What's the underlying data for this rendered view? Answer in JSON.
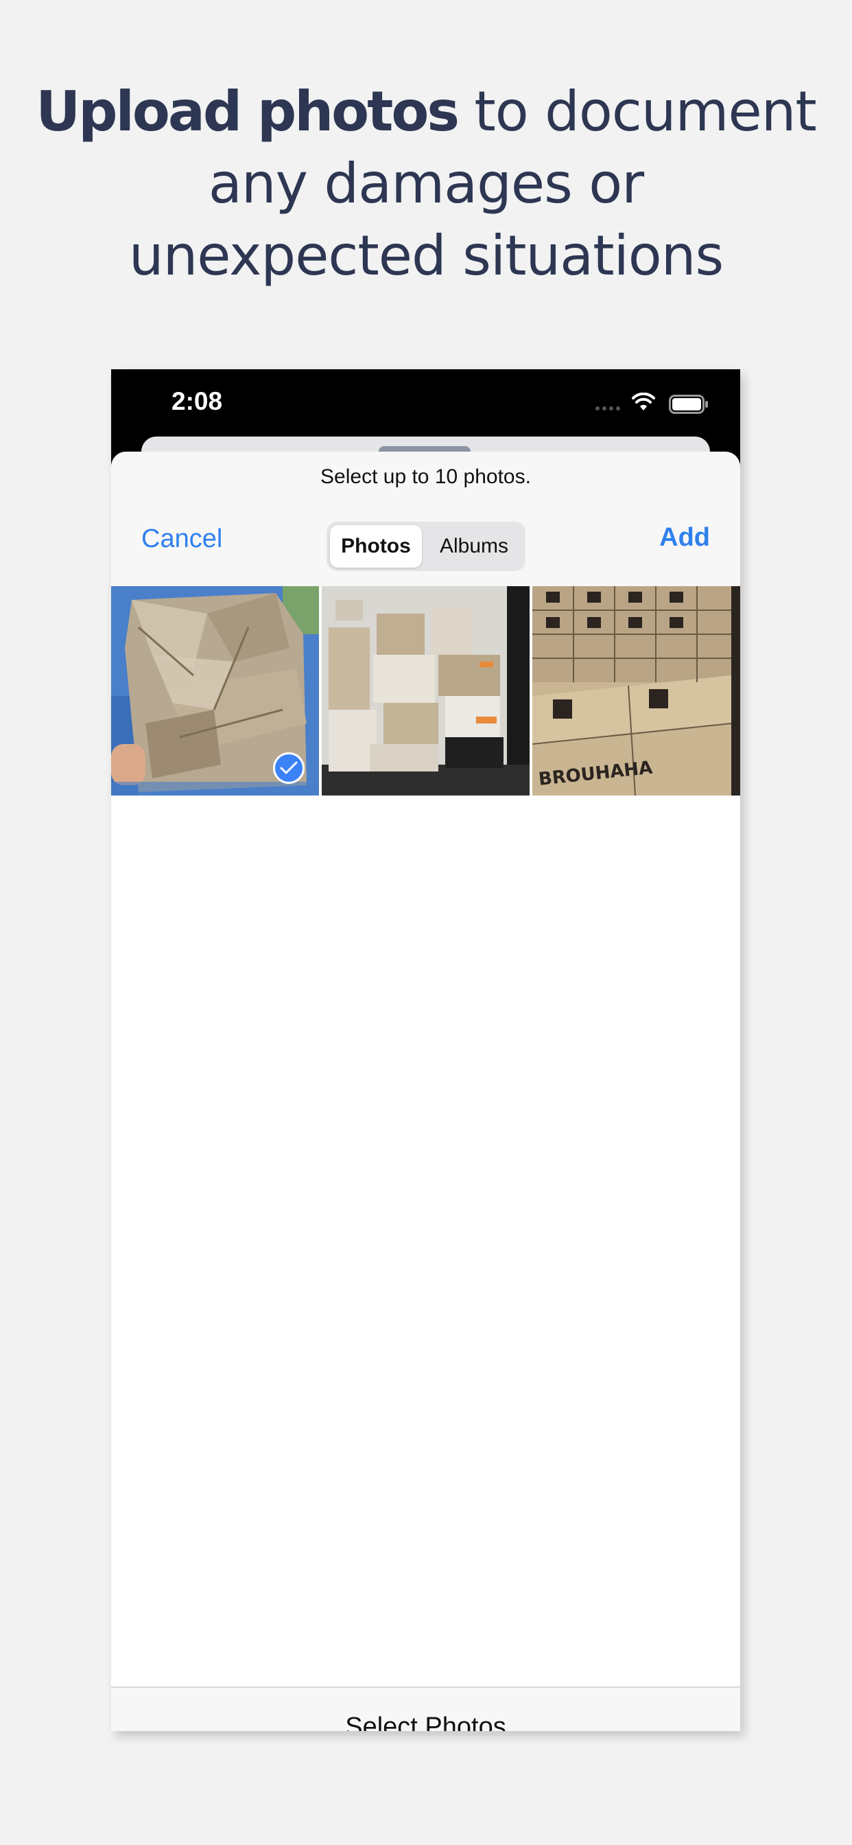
{
  "headline": {
    "bold": "Upload photos",
    "line1_rest": " to document",
    "line2": "any damages or",
    "line3": "unexpected situations"
  },
  "status_bar": {
    "time": "2:08"
  },
  "picker": {
    "prompt": "Select up to 10 photos.",
    "cancel_label": "Cancel",
    "add_label": "Add",
    "tabs": [
      {
        "label": "Photos",
        "selected": true
      },
      {
        "label": "Albums",
        "selected": false
      }
    ],
    "photos": [
      {
        "selected": true
      },
      {
        "selected": false
      },
      {
        "selected": false
      }
    ],
    "box_print": "BROUHAHA"
  },
  "bottom": {
    "select_photos_label": "Select Photos"
  },
  "colors": {
    "accent": "#2f80ed",
    "check": "#3b82f6",
    "headline": "#2d3753",
    "background": "#f2f2f2"
  }
}
